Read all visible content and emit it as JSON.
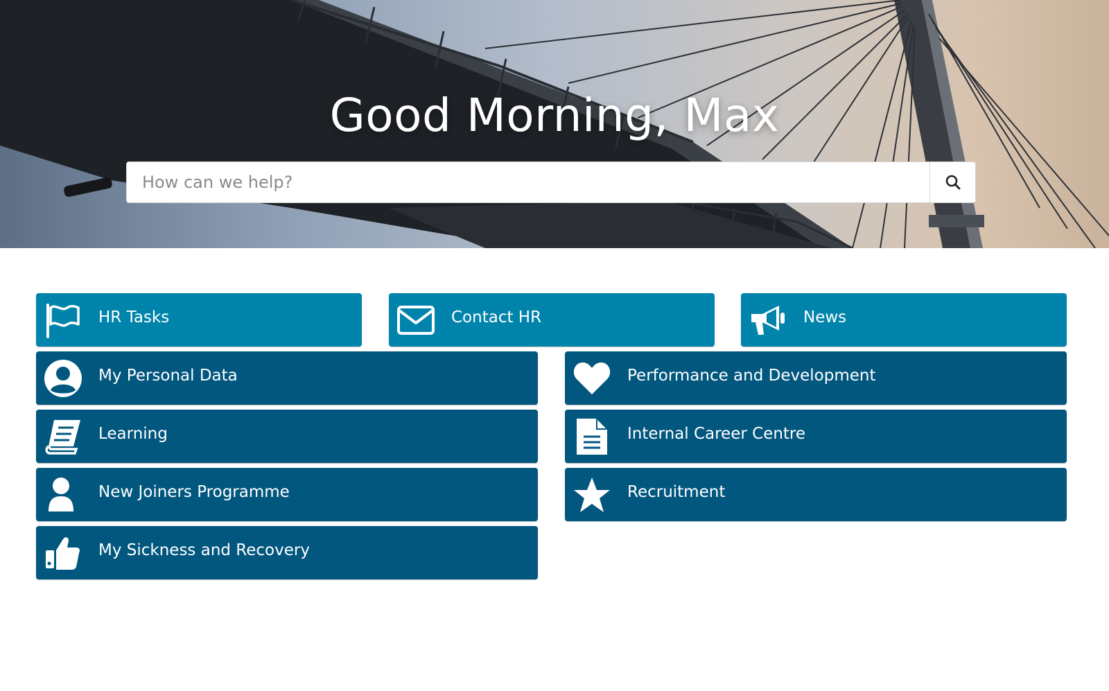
{
  "hero": {
    "greeting": "Good Morning, Max",
    "search": {
      "placeholder": "How can we help?",
      "button_icon": "search-icon"
    }
  },
  "colors": {
    "tile_light": "#0084ab",
    "tile_dark": "#02577f"
  },
  "top_tiles": [
    {
      "label": "HR Tasks",
      "icon": "flag-icon"
    },
    {
      "label": "Contact HR",
      "icon": "envelope-icon"
    },
    {
      "label": "News",
      "icon": "megaphone-icon"
    }
  ],
  "left_tiles": [
    {
      "label": "My Personal Data",
      "icon": "user-circle-icon"
    },
    {
      "label": "Learning",
      "icon": "book-icon"
    },
    {
      "label": "New Joiners Programme",
      "icon": "user-icon"
    },
    {
      "label": "My Sickness and Recovery",
      "icon": "thumbs-up-icon"
    }
  ],
  "right_tiles": [
    {
      "label": "Performance and Development",
      "icon": "heart-icon"
    },
    {
      "label": "Internal Career Centre",
      "icon": "document-icon"
    },
    {
      "label": "Recruitment",
      "icon": "star-icon"
    }
  ]
}
